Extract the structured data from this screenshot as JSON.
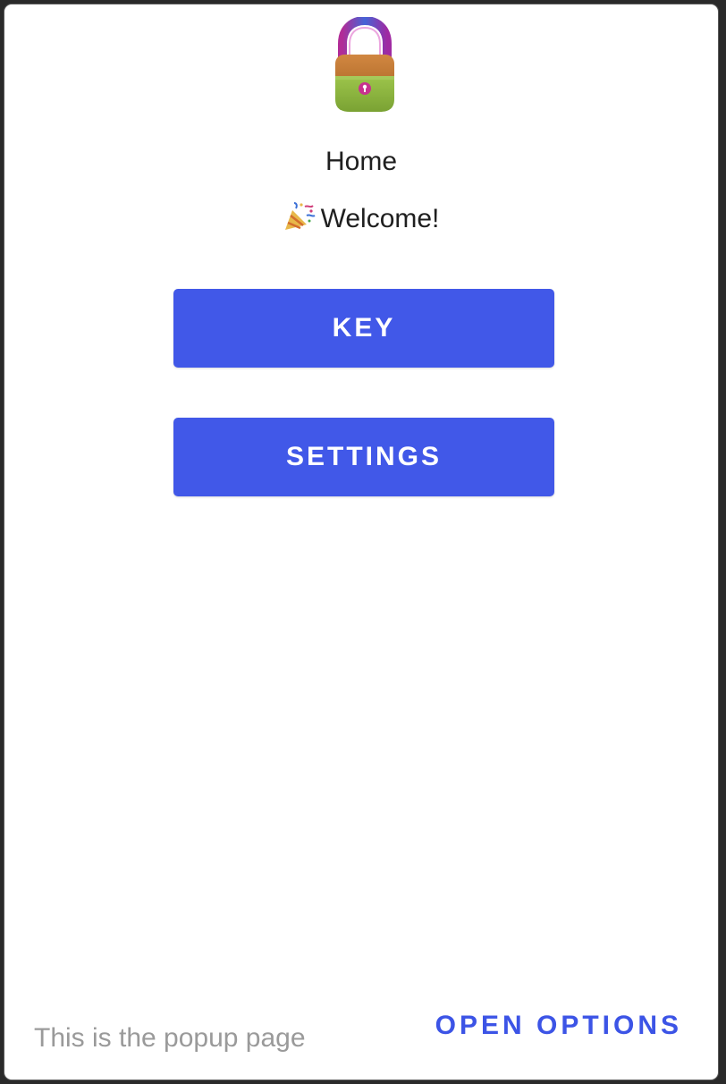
{
  "header": {
    "logo_icon": "padlock-icon",
    "title": "Home",
    "welcome_icon": "party-popper-icon",
    "welcome_text": "Welcome!"
  },
  "actions": {
    "key_label": "KEY",
    "settings_label": "SETTINGS"
  },
  "footer": {
    "description": "This is the popup page",
    "open_options_label": "OPEN OPTIONS"
  },
  "colors": {
    "primary": "#4158e8",
    "link": "#3c54e6",
    "muted_text": "#9a9a9a"
  }
}
